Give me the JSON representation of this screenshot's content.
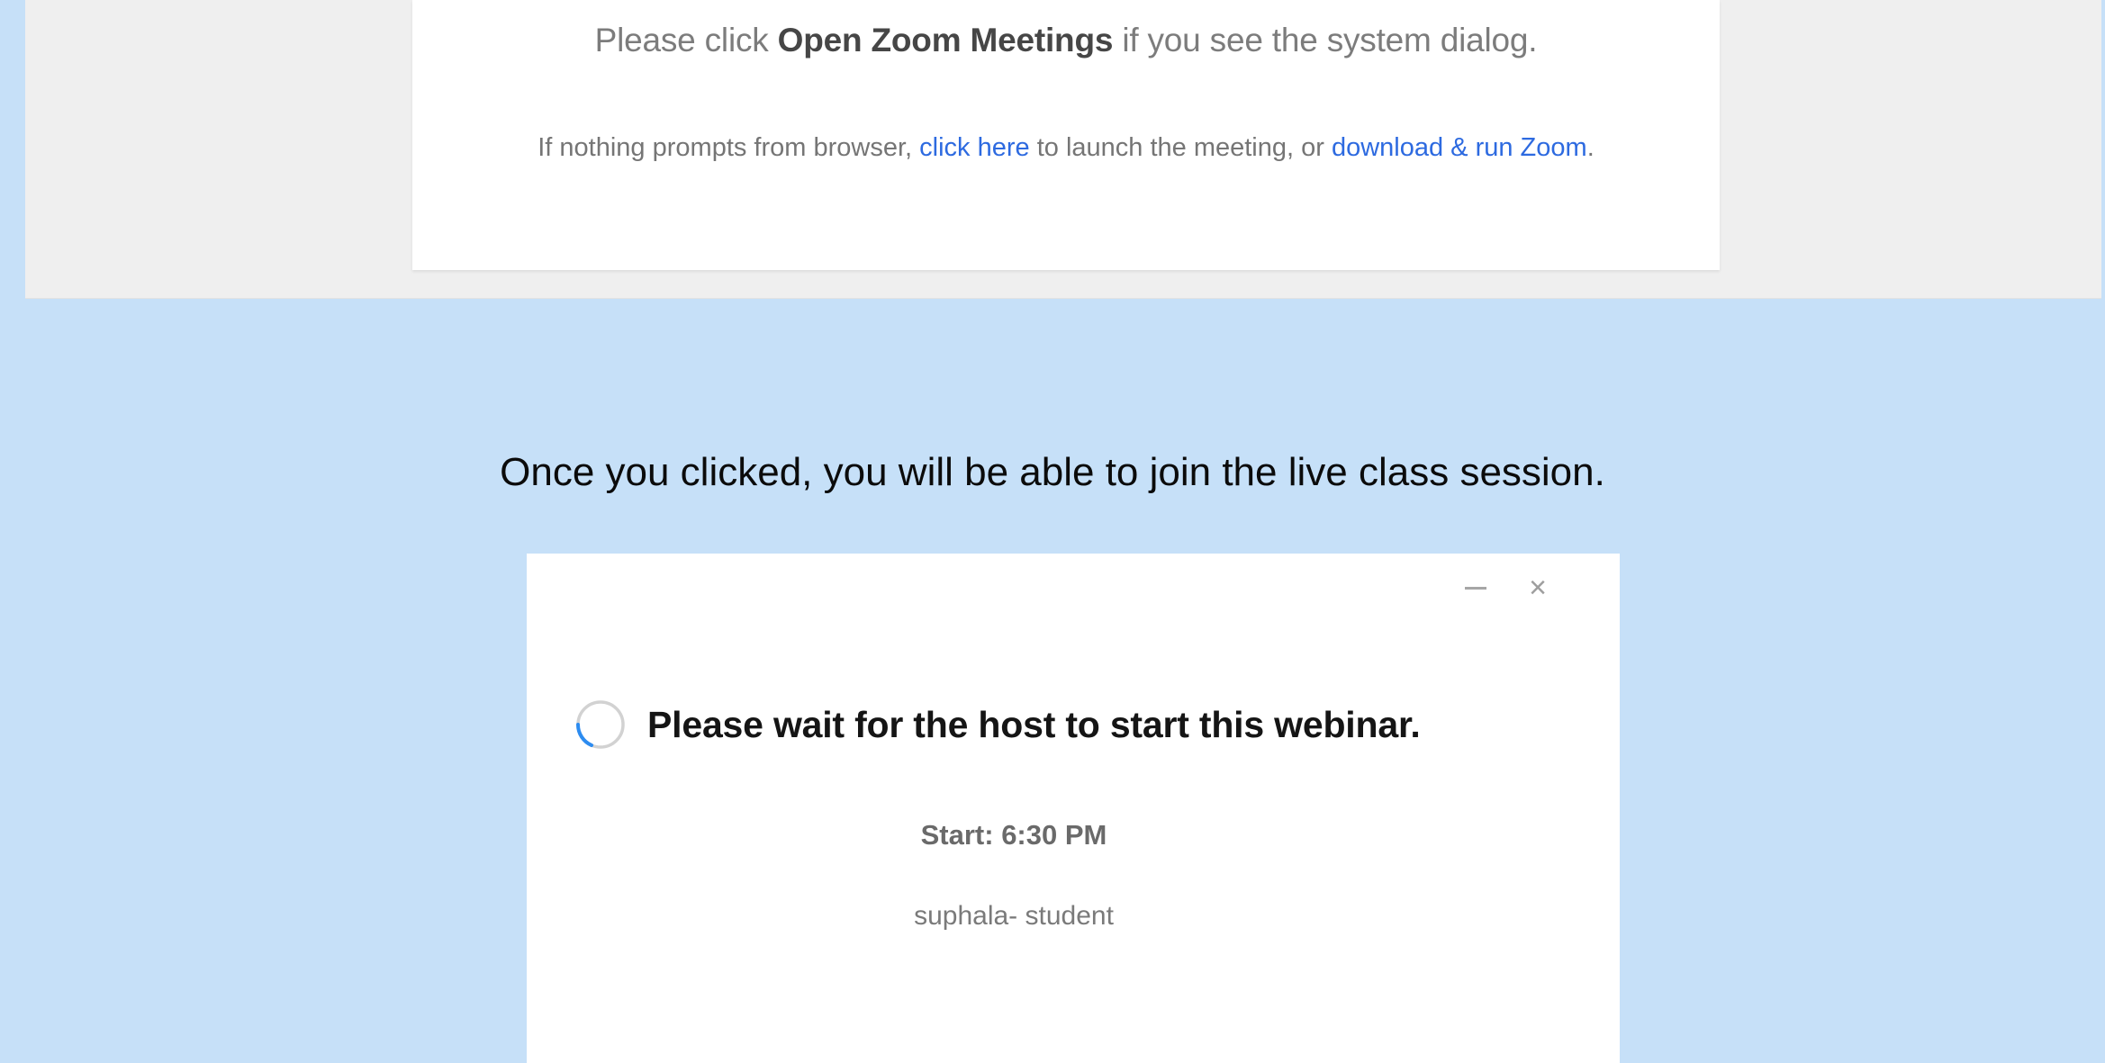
{
  "launch_page": {
    "line1_prefix": "Please click ",
    "line1_bold": "Open Zoom Meetings",
    "line1_suffix": " if you see the system dialog.",
    "line2_prefix": "If nothing prompts from browser, ",
    "click_here_link": "click here",
    "line2_middle": " to launch the meeting, or ",
    "download_link": "download & run Zoom",
    "line2_suffix": "."
  },
  "caption": "Once you clicked, you will be able to join the live class session.",
  "zoom_window": {
    "minimize_icon": "minimize-icon",
    "close_icon": "close-icon",
    "spinner_icon": "loading-spinner-icon",
    "wait_message": "Please wait for the host to start this webinar.",
    "start_time": "Start: 6:30 PM",
    "webinar_name": "suphala- student"
  },
  "colors": {
    "background": "#c6e0f8",
    "link": "#2d6ae0",
    "spinner_accent": "#2d8cf0"
  }
}
